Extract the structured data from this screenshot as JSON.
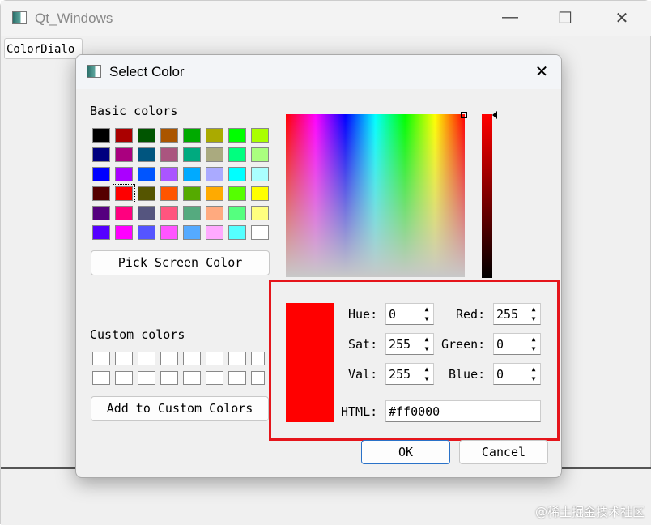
{
  "main_window": {
    "title": "Qt_Windows",
    "open_button": "ColorDialo",
    "minimize": "—",
    "maximize": "☐",
    "close": "✕"
  },
  "dialog": {
    "title": "Select Color",
    "close": "✕",
    "basic_colors_label": "Basic colors",
    "basic_colors": [
      [
        "#000000",
        "#aa0000",
        "#005500",
        "#aa5500",
        "#00aa00",
        "#aaaa00",
        "#00ff00",
        "#aaff00"
      ],
      [
        "#00007f",
        "#aa007f",
        "#00557f",
        "#aa557f",
        "#00aa7f",
        "#aaaa7f",
        "#00ff7f",
        "#aaff7f"
      ],
      [
        "#0000ff",
        "#aa00ff",
        "#0055ff",
        "#aa55ff",
        "#00aaff",
        "#aaaaff",
        "#00ffff",
        "#aaffff"
      ],
      [
        "#550000",
        "#ff0000",
        "#555500",
        "#ff5500",
        "#55aa00",
        "#ffaa00",
        "#55ff00",
        "#ffff00"
      ],
      [
        "#55007f",
        "#ff007f",
        "#55557f",
        "#ff557f",
        "#55aa7f",
        "#ffaa7f",
        "#55ff7f",
        "#ffff7f"
      ],
      [
        "#5500ff",
        "#ff00ff",
        "#5555ff",
        "#ff55ff",
        "#55aaff",
        "#ffaaff",
        "#55ffff",
        "#ffffff"
      ]
    ],
    "selected_basic": [
      3,
      1
    ],
    "pick_screen_color": "Pick Screen Color",
    "custom_colors_label": "Custom colors",
    "add_custom": "Add to Custom Colors",
    "current_color": "#ff0000",
    "fields": {
      "hue_label": "Hue:",
      "hue": "0",
      "sat_label": "Sat:",
      "sat": "255",
      "val_label": "Val:",
      "val": "255",
      "red_label": "Red:",
      "red": "255",
      "green_label": "Green:",
      "green": "0",
      "blue_label": "Blue:",
      "blue": "0",
      "html_label": "HTML:",
      "html": "#ff0000"
    },
    "ok": "OK",
    "cancel": "Cancel"
  },
  "watermark": "@稀土掘金技术社区",
  "highlight_color": "#e5151b"
}
